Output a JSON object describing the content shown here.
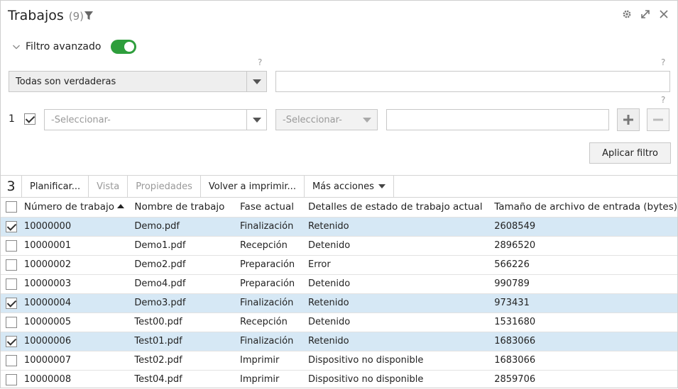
{
  "header": {
    "title": "Trabajos",
    "count": "(9)"
  },
  "filter": {
    "advanced_label": "Filtro avanzado",
    "advanced_enabled": true,
    "help": "?",
    "logic_select": "Todas son verdaderas",
    "row_number": "1",
    "row_checked": true,
    "field_select_placeholder": "-Seleccionar-",
    "operator_select_placeholder": "-Seleccionar-",
    "apply_label": "Aplicar filtro"
  },
  "toolbar": {
    "selected_count": "3",
    "buttons": [
      "Planificar...",
      "Vista",
      "Propiedades",
      "Volver a imprimir...",
      "Más acciones"
    ]
  },
  "table": {
    "columns": [
      "Número de trabajo",
      "Nombre de trabajo",
      "Fase actual",
      "Detalles de estado de trabajo actual",
      "Tamaño de archivo de entrada (bytes)"
    ],
    "rows": [
      {
        "checked": true,
        "num": "10000000",
        "name": "Demo.pdf",
        "phase": "Finalización",
        "status": "Retenido",
        "size": "2608549"
      },
      {
        "checked": false,
        "num": "10000001",
        "name": "Demo1.pdf",
        "phase": "Recepción",
        "status": "Detenido",
        "size": "2896520"
      },
      {
        "checked": false,
        "num": "10000002",
        "name": "Demo2.pdf",
        "phase": "Preparación",
        "status": "Error",
        "size": "566226"
      },
      {
        "checked": false,
        "num": "10000003",
        "name": "Demo4.pdf",
        "phase": "Preparación",
        "status": "Detenido",
        "size": "990789"
      },
      {
        "checked": true,
        "num": "10000004",
        "name": "Demo3.pdf",
        "phase": "Finalización",
        "status": "Retenido",
        "size": "973431"
      },
      {
        "checked": false,
        "num": "10000005",
        "name": "Test00.pdf",
        "phase": "Recepción",
        "status": "Detenido",
        "size": "1531680"
      },
      {
        "checked": true,
        "num": "10000006",
        "name": "Test01.pdf",
        "phase": "Finalización",
        "status": "Retenido",
        "size": "1683066"
      },
      {
        "checked": false,
        "num": "10000007",
        "name": "Test02.pdf",
        "phase": "Imprimir",
        "status": "Dispositivo no disponible",
        "size": "1683066"
      },
      {
        "checked": false,
        "num": "10000008",
        "name": "Test04.pdf",
        "phase": "Imprimir",
        "status": "Dispositivo no disponible",
        "size": "2859706"
      }
    ]
  },
  "colors": {
    "toggle_on": "#2e9e3c",
    "selected_row": "#d6e8f5"
  }
}
